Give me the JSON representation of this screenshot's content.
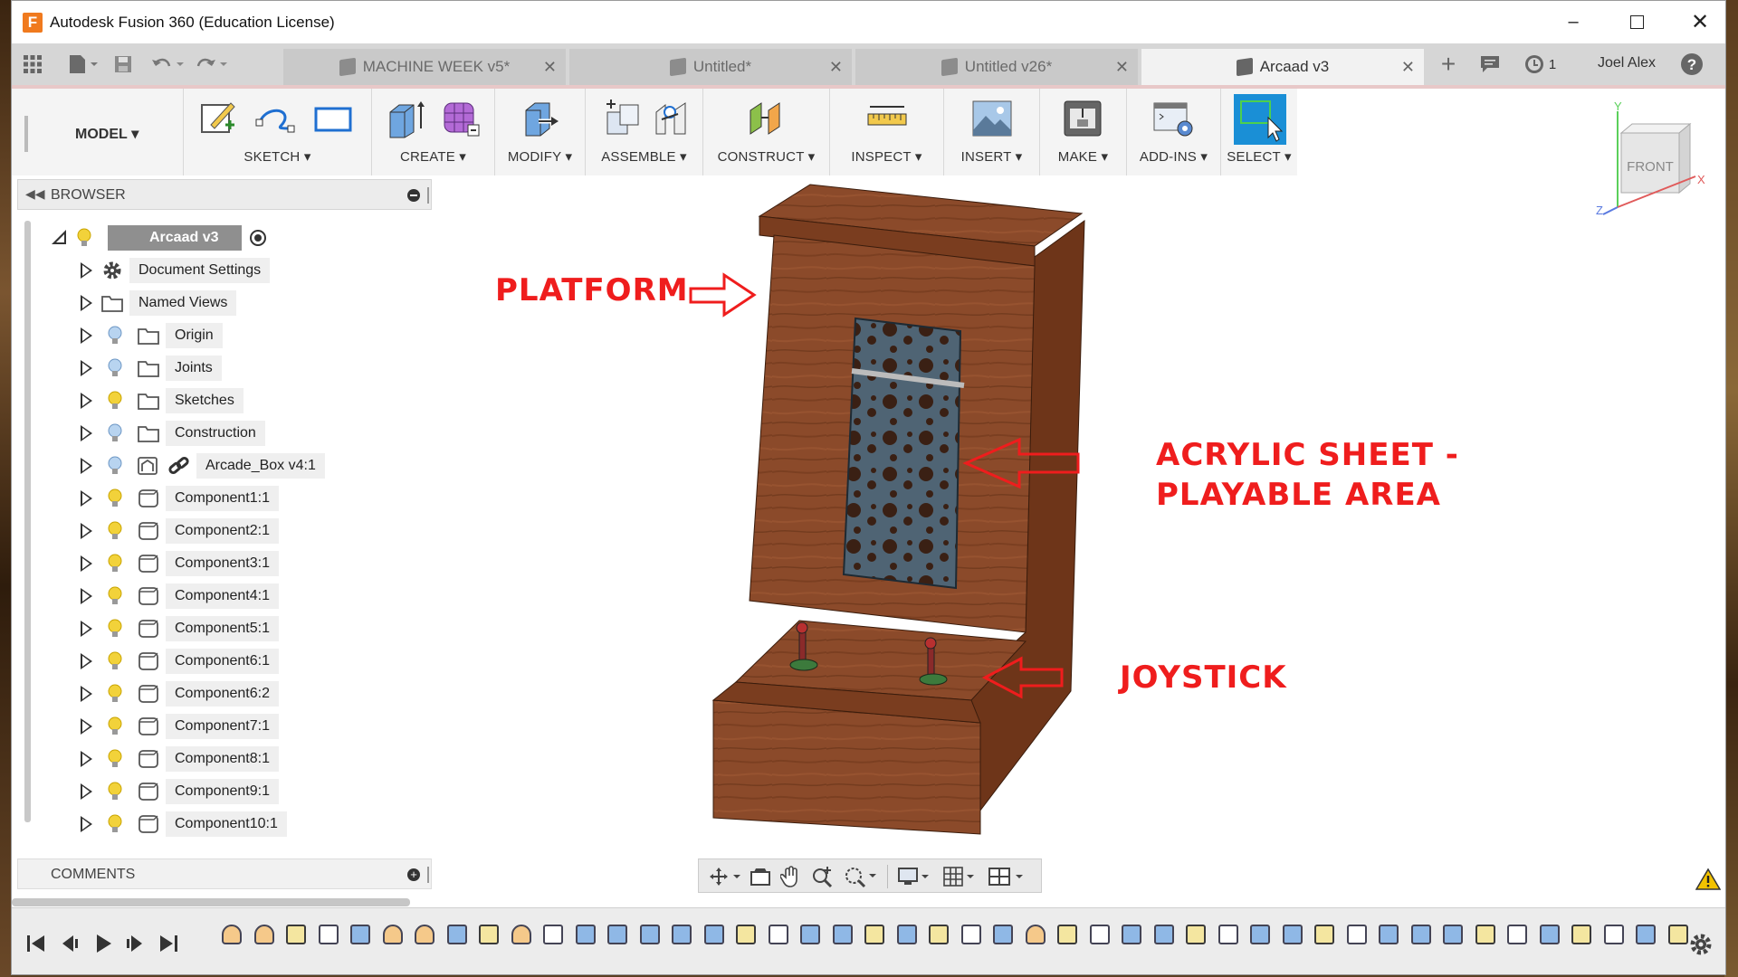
{
  "window": {
    "title": "Autodesk Fusion 360 (Education License)",
    "app_icon_letter": "F"
  },
  "tabs": [
    {
      "label": "MACHINE WEEK v5*",
      "active": false
    },
    {
      "label": "Untitled*",
      "active": false
    },
    {
      "label": "Untitled v26*",
      "active": false
    },
    {
      "label": "Arcaad v3",
      "active": true
    }
  ],
  "header_right": {
    "jobs_count": "1",
    "user": "Joel Alex"
  },
  "toolbar": {
    "workspace": "MODEL",
    "groups": [
      "SKETCH",
      "CREATE",
      "MODIFY",
      "ASSEMBLE",
      "CONSTRUCT",
      "INSPECT",
      "INSERT",
      "MAKE",
      "ADD-INS",
      "SELECT"
    ]
  },
  "browser": {
    "title": "BROWSER",
    "root": "Arcaad v3",
    "items": [
      {
        "label": "Document Settings",
        "icon": "gear-icon"
      },
      {
        "label": "Named Views",
        "icon": "folder-icon"
      },
      {
        "label": "Origin",
        "icon": "folder-icon",
        "bulb": "off"
      },
      {
        "label": "Joints",
        "icon": "folder-icon",
        "bulb": "off"
      },
      {
        "label": "Sketches",
        "icon": "folder-icon",
        "bulb": "on"
      },
      {
        "label": "Construction",
        "icon": "folder-icon",
        "bulb": "off"
      },
      {
        "label": "Arcade_Box v4:1",
        "icon": "link-icon",
        "bulb": "off"
      },
      {
        "label": "Component1:1",
        "icon": "component-icon",
        "bulb": "on"
      },
      {
        "label": "Component2:1",
        "icon": "component-icon",
        "bulb": "on"
      },
      {
        "label": "Component3:1",
        "icon": "component-icon",
        "bulb": "on"
      },
      {
        "label": "Component4:1",
        "icon": "component-icon",
        "bulb": "on"
      },
      {
        "label": "Component5:1",
        "icon": "component-icon",
        "bulb": "on"
      },
      {
        "label": "Component6:1",
        "icon": "component-icon",
        "bulb": "on"
      },
      {
        "label": "Component6:2",
        "icon": "component-icon",
        "bulb": "on"
      },
      {
        "label": "Component7:1",
        "icon": "component-icon",
        "bulb": "on"
      },
      {
        "label": "Component8:1",
        "icon": "component-icon",
        "bulb": "on"
      },
      {
        "label": "Component9:1",
        "icon": "component-icon",
        "bulb": "on"
      },
      {
        "label": "Component10:1",
        "icon": "component-icon",
        "bulb": "on"
      }
    ]
  },
  "comments": {
    "title": "COMMENTS"
  },
  "viewcube": {
    "face": "FRONT",
    "axes": [
      "Y",
      "X",
      "Z"
    ]
  },
  "annotations": {
    "platform": "PLATFORM",
    "acrylic_line1": "ACRYLIC SHEET -",
    "acrylic_line2": "PLAYABLE AREA",
    "joystick": "JOYSTICK"
  },
  "colors": {
    "annotation": "#ef1d1d",
    "select_active": "#1a8fd6",
    "wood": "#8b4a2a"
  }
}
